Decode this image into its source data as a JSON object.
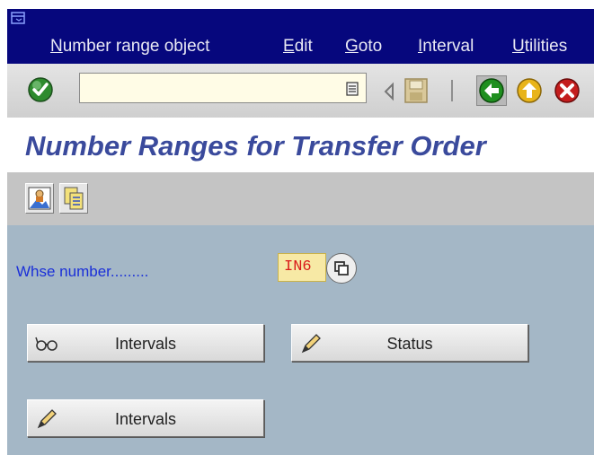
{
  "menu": {
    "items": [
      {
        "mnemonic": "N",
        "rest": "umber range object"
      },
      {
        "mnemonic": "E",
        "rest": "dit"
      },
      {
        "mnemonic": "G",
        "rest": "oto"
      },
      {
        "mnemonic": "I",
        "rest": "nterval"
      },
      {
        "mnemonic": "U",
        "rest": "tilities"
      }
    ]
  },
  "toolbar": {
    "command_value": "",
    "icons": [
      "enter-icon",
      "history-icon",
      "back-arrow-icon",
      "save-icon",
      "back-icon",
      "exit-icon",
      "cancel-icon"
    ]
  },
  "title": "Number Ranges for Transfer Order",
  "app_toolbar": {
    "icons": [
      "overview-icon",
      "copy-icon"
    ]
  },
  "form": {
    "whse_label": "Whse number.........",
    "whse_value": "IN6"
  },
  "buttons": {
    "intervals_display": "Intervals",
    "status_change": "Status",
    "intervals_change": "Intervals"
  },
  "colors": {
    "menubar": "#06077d",
    "title": "#3a4a9c",
    "content_bg": "#a4b7c6",
    "label": "#1a2fd8"
  }
}
